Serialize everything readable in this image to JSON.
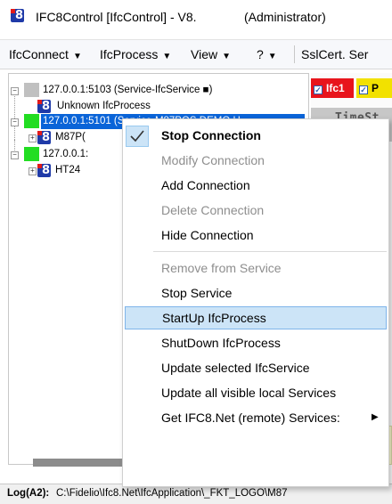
{
  "window": {
    "title": "IFC8Control [IfcControl] - V8.",
    "title_suffix": "(Administrator)"
  },
  "menubar": {
    "items": [
      "IfcConnect",
      "IfcProcess",
      "View",
      "?",
      "SslCert. Ser"
    ]
  },
  "tree": {
    "nodes": [
      {
        "label": "127.0.0.1:5103 (Service-IfcService ■)",
        "status_color": "#c0c0c0"
      },
      {
        "label": "Unknown IfcProcess"
      },
      {
        "label": "127.0.0.1:5101 (Service-M87POS DEMO H",
        "status_color": "#22dd22",
        "selected": true
      },
      {
        "label": "M87P("
      },
      {
        "label": "127.0.0.1:",
        "status_color": "#22dd22"
      },
      {
        "label": "HT24"
      }
    ]
  },
  "right_panel": {
    "tag1": "Ifc1",
    "tag2": "P",
    "tag1_color": "#e8141c",
    "tag2_color": "#f2e100",
    "column_header": "TimeSt"
  },
  "context_menu": {
    "items": [
      {
        "label": "Stop Connection",
        "bold": true,
        "checked": true
      },
      {
        "label": "Modify Connection",
        "disabled": true
      },
      {
        "label": "Add Connection"
      },
      {
        "label": "Delete Connection",
        "disabled": true
      },
      {
        "label": "Hide Connection"
      },
      {
        "label": "Remove from Service",
        "disabled": true
      },
      {
        "label": "Stop Service"
      },
      {
        "label": "StartUp IfcProcess",
        "highlighted": true
      },
      {
        "label": "ShutDown IfcProcess"
      },
      {
        "label": "Update selected IfcService"
      },
      {
        "label": "Update all visible local Services"
      },
      {
        "label": "Get IFC8.Net (remote) Services:",
        "submenu": true
      }
    ]
  },
  "statusbar": {
    "label": "Log(A2):",
    "path": "C:\\Fidelio\\Ifc8.Net\\IfcApplication\\_FKT_LOGO\\M87"
  }
}
